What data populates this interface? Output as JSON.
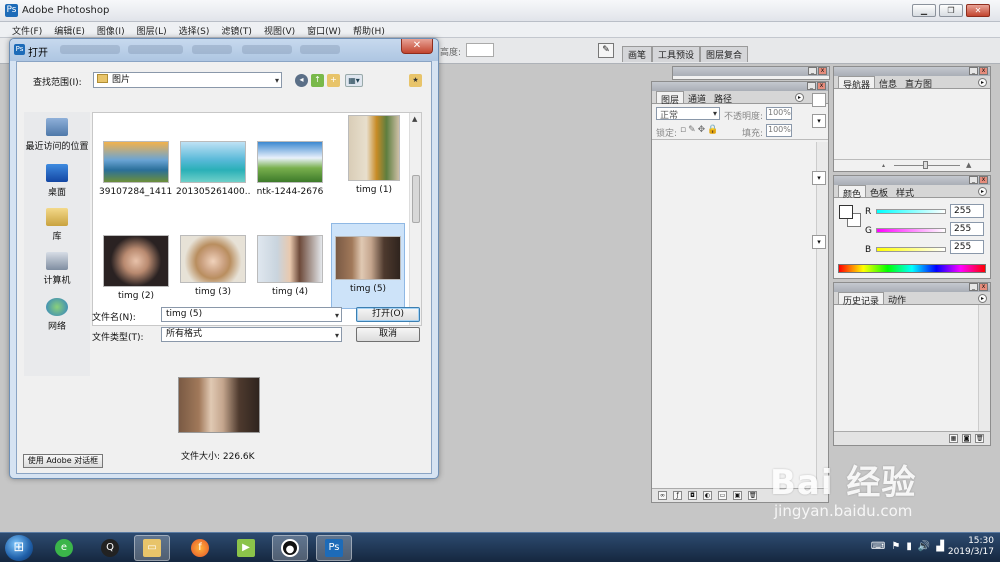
{
  "app": {
    "title": "Adobe Photoshop"
  },
  "menu": [
    "文件(F)",
    "编辑(E)",
    "图像(I)",
    "图层(L)",
    "选择(S)",
    "滤镜(T)",
    "视图(V)",
    "窗口(W)",
    "帮助(H)"
  ],
  "options_bar": {
    "height_label": "高度:",
    "tabs": [
      "画笔",
      "工具预设",
      "图层复合"
    ]
  },
  "layers_panel": {
    "tabs": [
      "图层",
      "通道",
      "路径"
    ],
    "blend_mode": "正常",
    "opacity_label": "不透明度:",
    "opacity_value": "100%",
    "lock_label": "锁定:",
    "fill_label": "填充:",
    "fill_value": "100%"
  },
  "navigator_panel": {
    "tabs": [
      "导航器",
      "信息",
      "直方图"
    ]
  },
  "color_panel": {
    "tabs": [
      "颜色",
      "色板",
      "样式"
    ],
    "channels": [
      {
        "label": "R",
        "value": "255"
      },
      {
        "label": "G",
        "value": "255"
      },
      {
        "label": "B",
        "value": "255"
      }
    ]
  },
  "history_panel": {
    "tabs": [
      "历史记录",
      "动作"
    ]
  },
  "dialog": {
    "title": "打开",
    "look_in_label": "查找范围(I):",
    "look_in_value": "图片",
    "places": [
      "最近访问的位置",
      "桌面",
      "库",
      "计算机",
      "网络"
    ],
    "files": [
      "39107284_1411...",
      "201305261400...",
      "ntk-1244-2676",
      "timg (1)",
      "timg (2)",
      "timg (3)",
      "timg (4)",
      "timg (5)"
    ],
    "filename_label": "文件名(N):",
    "filename_value": "timg (5)",
    "filetype_label": "文件类型(T):",
    "filetype_value": "所有格式",
    "open_button": "打开(O)",
    "cancel_button": "取消",
    "filesize": "文件大小: 226.6K",
    "adobe_dialog_button": "使用 Adobe 对话框"
  },
  "taskbar": {
    "time": "15:30",
    "date": "2019/3/17"
  },
  "watermark": {
    "brand": "Bai 经验",
    "url": "jingyan.baidu.com"
  }
}
